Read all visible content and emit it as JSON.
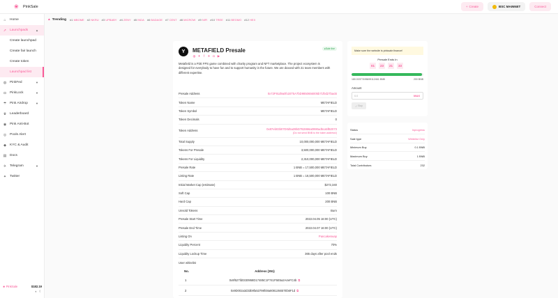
{
  "app": {
    "name": "PinkSale"
  },
  "topbar": {
    "create_label": "Create",
    "network_label": "BSC MAINNET",
    "connect_label": "Connect"
  },
  "sidebar": {
    "items": [
      {
        "label": "Home",
        "icon": "home-icon"
      },
      {
        "label": "Launchpads",
        "icon": "rocket-icon",
        "active": true
      },
      {
        "label": "Create launchpad",
        "sub": true
      },
      {
        "label": "Create fair launch",
        "sub": true
      },
      {
        "label": "Create token",
        "sub": true
      },
      {
        "label": "Launchpad list",
        "sub": true,
        "active": true
      },
      {
        "label": "PinkFed",
        "icon": "lock-icon"
      },
      {
        "label": "PinkLock",
        "icon": "lock-icon"
      },
      {
        "label": "Pink Airdrop",
        "icon": "airdrop-icon"
      },
      {
        "label": "Leaderboard",
        "icon": "trophy-icon"
      },
      {
        "label": "Pink Anti-Bot",
        "icon": "robot-icon"
      },
      {
        "label": "Pools Alert",
        "icon": "bell-icon"
      },
      {
        "label": "KYC & Audit",
        "icon": "shield-icon"
      },
      {
        "label": "Docs",
        "icon": "doc-icon"
      },
      {
        "label": "Telegram",
        "icon": "telegram-icon"
      },
      {
        "label": "Twitter",
        "icon": "twitter-icon"
      }
    ],
    "footer": {
      "token": "PinkSale",
      "price": "$182.19"
    }
  },
  "trending": {
    "label": "Trending",
    "items": [
      {
        "rank": "#1",
        "name": "MBOME"
      },
      {
        "rank": "#2",
        "name": "NKRU"
      },
      {
        "rank": "#3",
        "name": "UPBABY"
      },
      {
        "rank": "#4",
        "name": "ZENY"
      },
      {
        "rank": "#5",
        "name": "INDA"
      },
      {
        "rank": "#6",
        "name": "BADAGE"
      },
      {
        "rank": "#7",
        "name": "CENT"
      },
      {
        "rank": "#8",
        "name": "MICROW"
      },
      {
        "rank": "#9",
        "name": "NIFI"
      },
      {
        "rank": "#10",
        "name": "TREE"
      },
      {
        "rank": "#11",
        "name": "BEGMO"
      },
      {
        "rank": "#12",
        "name": "HEX"
      }
    ]
  },
  "presale": {
    "title": "METAFIELD Presale",
    "logo_letter": "Y",
    "safu_label": "Sale live",
    "description": "Metafield is a P2E FPS game combined with charity program and NFT marketplace. The project ecosystem is designed for everybody to have fun and to support humanity in the future. We are doxxed with 21 team members with different expertise.",
    "rows": [
      {
        "k": "Presale Address",
        "v": "0x72F91d9a0fcd4T5A7bD9850656005b71f0d27bacB",
        "pink": true
      },
      {
        "k": "Token Name",
        "v": "METAFIELD"
      },
      {
        "k": "Token Symbol",
        "v": "METAFIELD"
      },
      {
        "k": "Token Decimals",
        "v": "0"
      },
      {
        "k": "Token Address",
        "v": "0x87eb03b07D0d5a39bD7B2866a0990ad5ca5fB2073",
        "note": "(Do not send BNB to the token address!)",
        "pink": true,
        "tall": true
      },
      {
        "k": "Total Supply",
        "v": "10,000,000,000 METAFIELD"
      },
      {
        "k": "Tokens For Presale",
        "v": "3,500,000,000 METAFIELD"
      },
      {
        "k": "Tokens For Liquidity",
        "v": "2,310,000,000 METAFIELD"
      },
      {
        "k": "Presale Rate",
        "v": "1 BNB = 17,500,000 METAFIELD"
      },
      {
        "k": "Listing Rate",
        "v": "1 BNB = 16,500,000 METAFIELD"
      },
      {
        "k": "Initial Market Cap (estimate)",
        "v": "$272,340"
      },
      {
        "k": "Soft Cap",
        "v": "100 BNB"
      },
      {
        "k": "Hard Cap",
        "v": "200 BNB"
      },
      {
        "k": "Unsold Tokens",
        "v": "Burn"
      },
      {
        "k": "Presale Start Time",
        "v": "2022.04.05 16:00 (UTC)"
      },
      {
        "k": "Presale End Time",
        "v": "2022.04.07 16:00 (UTC)"
      },
      {
        "k": "Listing On",
        "v": "Pancakeswap",
        "pink": true
      },
      {
        "k": "Liquidity Percent",
        "v": "70%"
      },
      {
        "k": "Liquidity Lockup Time",
        "v": "365 days after pool ends"
      },
      {
        "k": "User whitelist",
        "v": ""
      }
    ],
    "whitelist": {
      "col_no": "No.",
      "col_address": "Address (351)",
      "rows": [
        {
          "no": "1",
          "address": "0x9f527fd0330958D17485C1F741F5E5a2A4eFC4b"
        },
        {
          "no": "2",
          "address": "0x9D002a3d33b9fa53798f48a8081284B7Eb6F1d"
        }
      ]
    }
  },
  "buy": {
    "warning": "Make sure the website is pinksale.finance!",
    "ends_label": "Presale Ends In",
    "timer": [
      "01",
      "23",
      "21",
      "33"
    ],
    "progress_fraction": 0.98,
    "progress_left": "180.00377495699112461 BNB",
    "progress_right": "200 BNB",
    "amount_label": "Amount",
    "amount_placeholder": "0.0",
    "max_label": "MAX",
    "buy_label": "Buy"
  },
  "status": {
    "rows": [
      {
        "k": "Status",
        "v": "Inprogress",
        "pink": true
      },
      {
        "k": "Sale type",
        "v": "Whitelist Only",
        "pink": true
      },
      {
        "k": "Minimum Buy",
        "v": "0.1 BNB"
      },
      {
        "k": "Maximum Buy",
        "v": "1 BNB"
      },
      {
        "k": "Total Contributors",
        "v": "232"
      }
    ]
  },
  "colors": {
    "accent": "#f95997",
    "success": "#35b85c",
    "warning_bg": "#fff9e0"
  }
}
